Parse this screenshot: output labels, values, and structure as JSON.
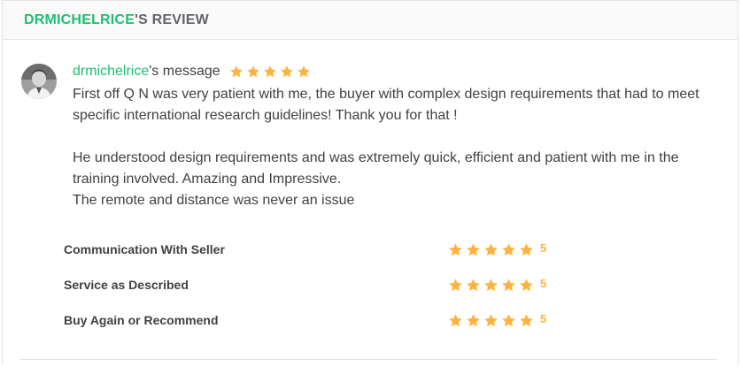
{
  "header": {
    "username": "DRMICHELRICE",
    "title_suffix": "'S REVIEW"
  },
  "message": {
    "username": "drmichelrice",
    "suffix": "'s message",
    "stars": 5,
    "body": "First off Q N was very patient with me, the buyer with complex design requirements that had to meet specific international research guidelines! Thank you for that !\n\nHe understood design requirements and was extremely quick, efficient and patient with me in the training involved. Amazing and Impressive.\nThe remote and distance was never an issue"
  },
  "ratings": [
    {
      "label": "Communication With Seller",
      "stars": 5,
      "score": "5"
    },
    {
      "label": "Service as Described",
      "stars": 5,
      "score": "5"
    },
    {
      "label": "Buy Again or Recommend",
      "stars": 5,
      "score": "5"
    }
  ],
  "colors": {
    "brand_green": "#1dbf73",
    "star_yellow": "#ffb33e",
    "text": "#404145"
  },
  "icons": {
    "avatar": "user-avatar-photo",
    "star": "star-icon"
  }
}
